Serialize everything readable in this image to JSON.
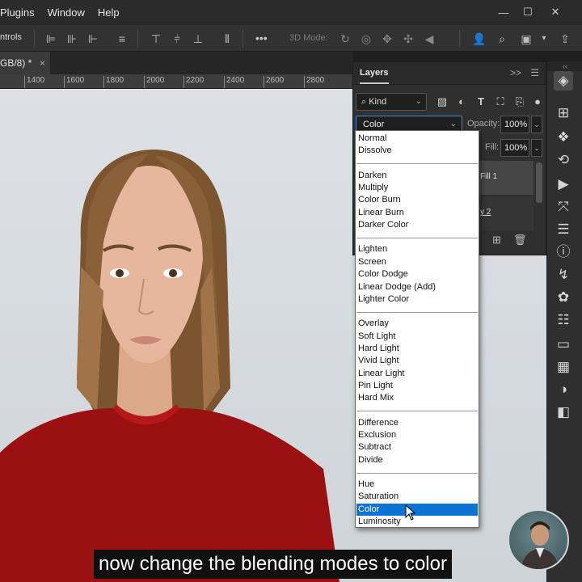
{
  "menubar": {
    "items": [
      "Plugins",
      "Window",
      "Help"
    ],
    "window_controls": [
      "minimize",
      "maximize",
      "close"
    ]
  },
  "options_bar": {
    "label": "ntrols",
    "more_label": "•••",
    "mode_label": "3D Mode:"
  },
  "document_tab": {
    "title": "GB/8) *",
    "close": "×"
  },
  "ruler": {
    "labels": [
      "1400",
      "1600",
      "1800",
      "2000",
      "2200",
      "2400",
      "2600",
      "2800"
    ]
  },
  "layers_panel": {
    "title": "Layers",
    "collapse_icon": ">>",
    "kind_label": "Kind",
    "blend_mode_value": "Color",
    "opacity_label": "Opacity:",
    "opacity_value": "100%",
    "fill_label": "Fill:",
    "fill_value": "100%",
    "layers": [
      "Fill 1",
      "y 2"
    ]
  },
  "blend_dropdown": {
    "groups": [
      [
        "Normal",
        "Dissolve"
      ],
      [
        "Darken",
        "Multiply",
        "Color Burn",
        "Linear Burn",
        "Darker Color"
      ],
      [
        "Lighten",
        "Screen",
        "Color Dodge",
        "Linear Dodge (Add)",
        "Lighter Color"
      ],
      [
        "Overlay",
        "Soft Light",
        "Hard Light",
        "Vivid Light",
        "Linear Light",
        "Pin Light",
        "Hard Mix"
      ],
      [
        "Difference",
        "Exclusion",
        "Subtract",
        "Divide"
      ],
      [
        "Hue",
        "Saturation",
        "Color",
        "Luminosity"
      ]
    ],
    "selected": "Color"
  },
  "subtitle": {
    "text": "now change the blending modes to color"
  },
  "colors": {
    "selection": "#0a73d4",
    "panel": "#2f2f2f",
    "shirt": "#9b1010"
  },
  "icons": {
    "right_column": [
      "layers-icon",
      "table-icon",
      "3d-icon",
      "history-icon",
      "play-icon",
      "paths-icon",
      "adjustments-icon",
      "info-icon",
      "brush-settings-icon",
      "swatches-icon",
      "properties-icon",
      "gradients-icon",
      "patterns-icon",
      "channels-icon",
      "styles-icon"
    ]
  }
}
